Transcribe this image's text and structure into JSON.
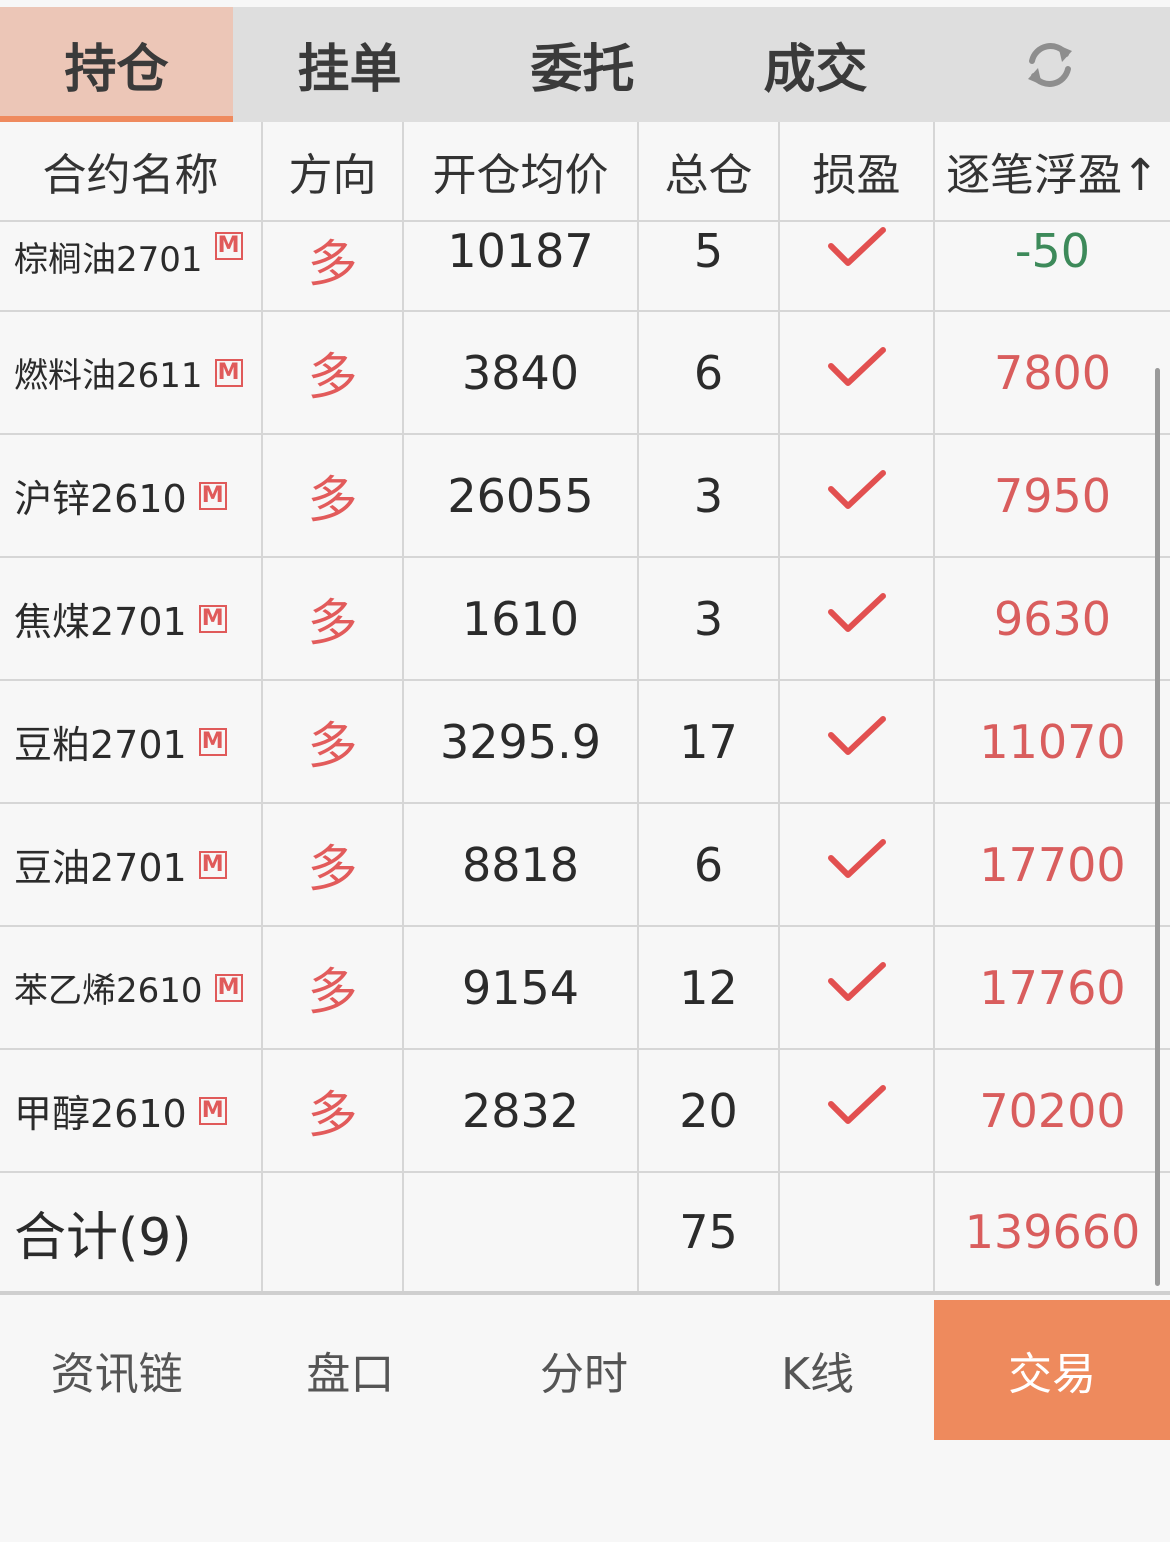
{
  "tabs": [
    {
      "label": "持仓",
      "active": true
    },
    {
      "label": "挂单",
      "active": false
    },
    {
      "label": "委托",
      "active": false
    },
    {
      "label": "成交",
      "active": false
    }
  ],
  "refresh_icon": "refresh-icon",
  "table": {
    "headers": [
      "合约名称",
      "方向",
      "开仓均价",
      "总仓",
      "损盈",
      "逐笔浮盈↑"
    ],
    "rows": [
      {
        "name": "棕榈油2701",
        "badge": "M",
        "direction": "多",
        "avg_price": "10187",
        "qty": "5",
        "pl": "-50",
        "pl_sign": "neg"
      },
      {
        "name": "燃料油2611",
        "badge": "M",
        "direction": "多",
        "avg_price": "3840",
        "qty": "6",
        "pl": "7800",
        "pl_sign": "pos"
      },
      {
        "name": "沪锌2610",
        "badge": "M",
        "direction": "多",
        "avg_price": "26055",
        "qty": "3",
        "pl": "7950",
        "pl_sign": "pos"
      },
      {
        "name": "焦煤2701",
        "badge": "M",
        "direction": "多",
        "avg_price": "1610",
        "qty": "3",
        "pl": "9630",
        "pl_sign": "pos"
      },
      {
        "name": "豆粕2701",
        "badge": "M",
        "direction": "多",
        "avg_price": "3295.9",
        "qty": "17",
        "pl": "11070",
        "pl_sign": "pos"
      },
      {
        "name": "豆油2701",
        "badge": "M",
        "direction": "多",
        "avg_price": "8818",
        "qty": "6",
        "pl": "17700",
        "pl_sign": "pos"
      },
      {
        "name": "苯乙烯2610",
        "badge": "M",
        "direction": "多",
        "avg_price": "9154",
        "qty": "12",
        "pl": "17760",
        "pl_sign": "pos"
      },
      {
        "name": "甲醇2610",
        "badge": "M",
        "direction": "多",
        "avg_price": "2832",
        "qty": "20",
        "pl": "70200",
        "pl_sign": "pos"
      }
    ],
    "total": {
      "label": "合计(9)",
      "qty": "75",
      "pl": "139660"
    }
  },
  "bottom_nav": [
    {
      "label": "资讯链",
      "active": false
    },
    {
      "label": "盘口",
      "active": false
    },
    {
      "label": "分时",
      "active": false
    },
    {
      "label": "K线",
      "active": false
    },
    {
      "label": "交易",
      "active": true
    }
  ],
  "colors": {
    "accent": "#ee8a5d",
    "active_tab_bg": "#ecc6b7",
    "profit": "#d95d5d",
    "loss": "#3d8a5a",
    "direction_long": "#e25b5b"
  }
}
